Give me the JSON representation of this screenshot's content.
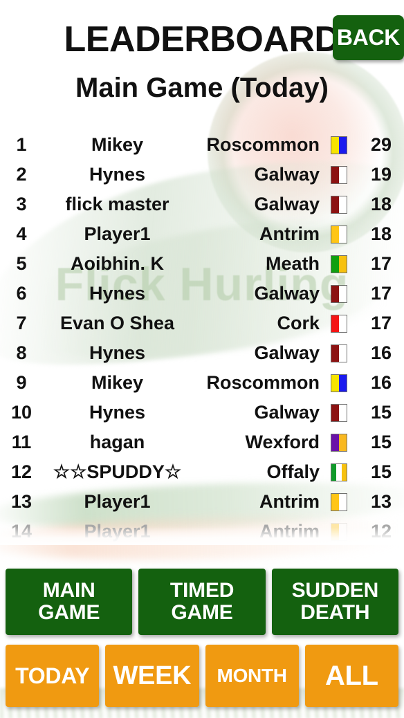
{
  "header": {
    "title": "LEADERBOARD",
    "subtitle": "Main Game (Today)",
    "back_label": "BACK"
  },
  "watermark": "Flick Hurling",
  "leaderboard": {
    "rows": [
      {
        "rank": "1",
        "player": "Mikey",
        "county": "Roscommon",
        "score": "29"
      },
      {
        "rank": "2",
        "player": "Hynes",
        "county": "Galway",
        "score": "19"
      },
      {
        "rank": "3",
        "player": "flick master",
        "county": "Galway",
        "score": "18"
      },
      {
        "rank": "4",
        "player": "Player1",
        "county": "Antrim",
        "score": "18"
      },
      {
        "rank": "5",
        "player": "Aoibhin. K",
        "county": "Meath",
        "score": "17"
      },
      {
        "rank": "6",
        "player": "Hynes",
        "county": "Galway",
        "score": "17"
      },
      {
        "rank": "7",
        "player": "Evan O Shea",
        "county": "Cork",
        "score": "17"
      },
      {
        "rank": "8",
        "player": "Hynes",
        "county": "Galway",
        "score": "16"
      },
      {
        "rank": "9",
        "player": "Mikey",
        "county": "Roscommon",
        "score": "16"
      },
      {
        "rank": "10",
        "player": "Hynes",
        "county": "Galway",
        "score": "15"
      },
      {
        "rank": "11",
        "player": "hagan",
        "county": "Wexford",
        "score": "15"
      },
      {
        "rank": "12",
        "player": "☆☆SPUDDY☆",
        "county": "Offaly",
        "score": "15"
      },
      {
        "rank": "13",
        "player": "Player1",
        "county": "Antrim",
        "score": "13"
      },
      {
        "rank": "14",
        "player": "Player1",
        "county": "Antrim",
        "score": "12"
      }
    ],
    "county_flag_colors": {
      "Roscommon": [
        "#f7e400",
        "#1a1aef"
      ],
      "Galway": [
        "#8c1212",
        "#ffffff"
      ],
      "Antrim": [
        "#ffc617",
        "#ffffff"
      ],
      "Meath": [
        "#10a010",
        "#f7c10f"
      ],
      "Cork": [
        "#f51414",
        "#ffffff"
      ],
      "Wexford": [
        "#6a12a8",
        "#f9b820"
      ],
      "Offaly": [
        "#109a2a",
        "#ffffff",
        "#f7c10f"
      ]
    }
  },
  "modes": [
    {
      "line1": "MAIN",
      "line2": "GAME"
    },
    {
      "line1": "TIMED",
      "line2": "GAME"
    },
    {
      "line1": "SUDDEN",
      "line2": "DEATH"
    }
  ],
  "periods": [
    {
      "label": "TODAY"
    },
    {
      "label": "WEEK"
    },
    {
      "label": "MONTH"
    },
    {
      "label": "ALL"
    }
  ]
}
